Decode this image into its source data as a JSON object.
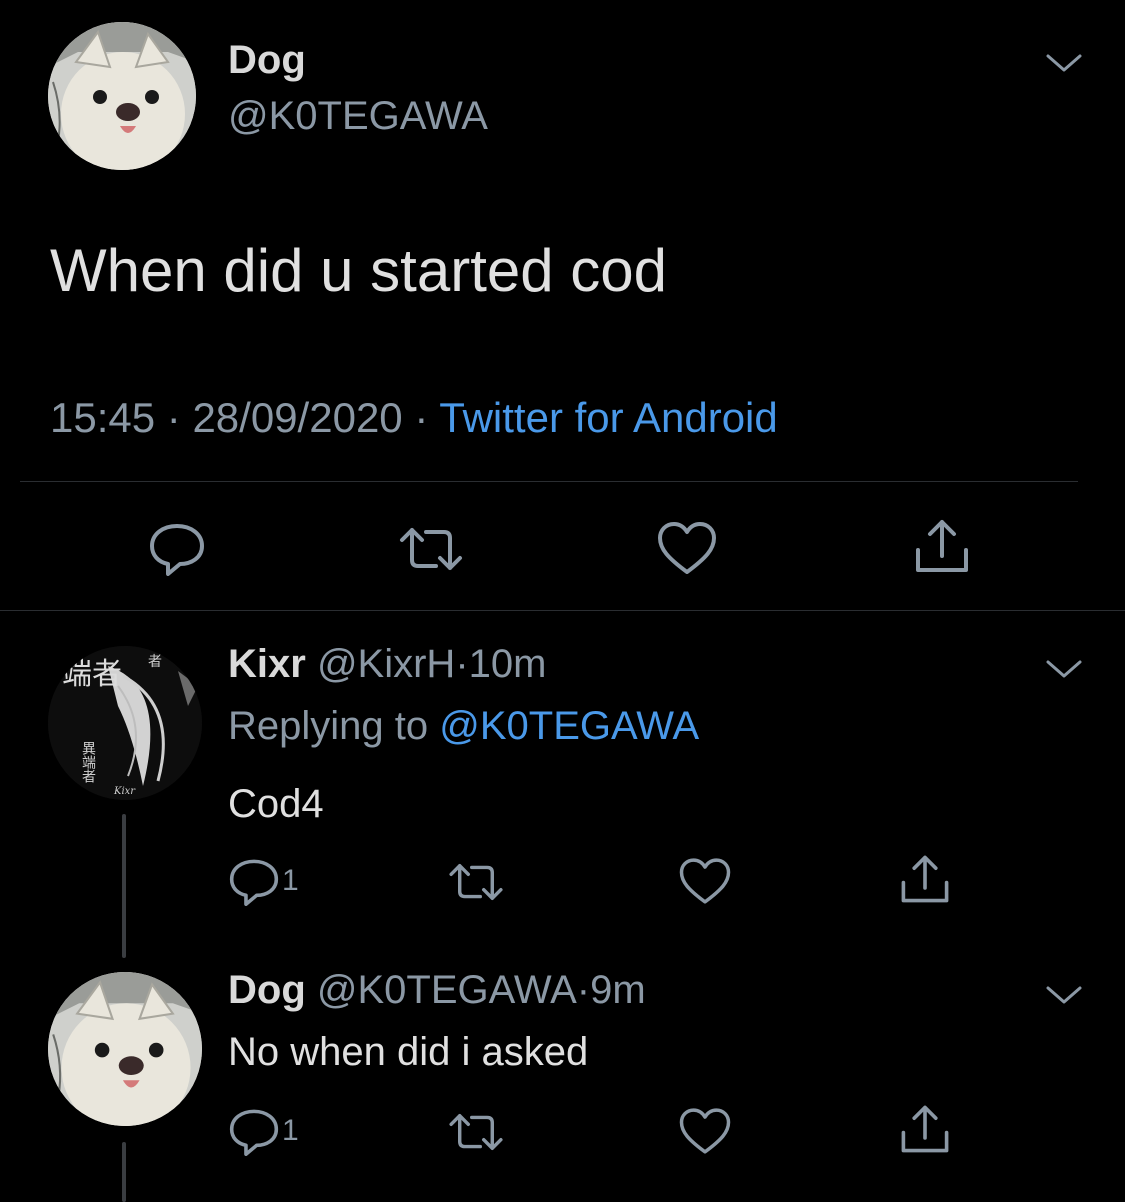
{
  "main_tweet": {
    "display_name": "Dog",
    "handle": "@K0TEGAWA",
    "text": "When did u started cod",
    "time": "15:45",
    "date": "28/09/2020",
    "source": "Twitter for Android",
    "separator": "·"
  },
  "replies": [
    {
      "display_name": "Kixr",
      "handle": "@KixrH",
      "age": "10m",
      "replying_prefix": "Replying to",
      "replying_to": "@K0TEGAWA",
      "text": "Cod4",
      "reply_count": "1"
    },
    {
      "display_name": "Dog",
      "handle": "@K0TEGAWA",
      "age": "9m",
      "text": "No when did i asked",
      "reply_count": "1"
    }
  ],
  "avatar_kixr": {
    "logo_text_main": "端者",
    "logo_text_side": "異端者",
    "logo_text_corner": "者",
    "signature": "Kixr"
  },
  "icons": {
    "menu": "chevron-down-icon",
    "reply": "reply-bubble-icon",
    "retweet": "retweet-icon",
    "like": "heart-icon",
    "share": "share-icon"
  },
  "colors": {
    "background": "#000000",
    "text": "#d9d9d9",
    "secondary": "#8b98a5",
    "link": "#4a99e9",
    "divider": "#2a2d31"
  }
}
